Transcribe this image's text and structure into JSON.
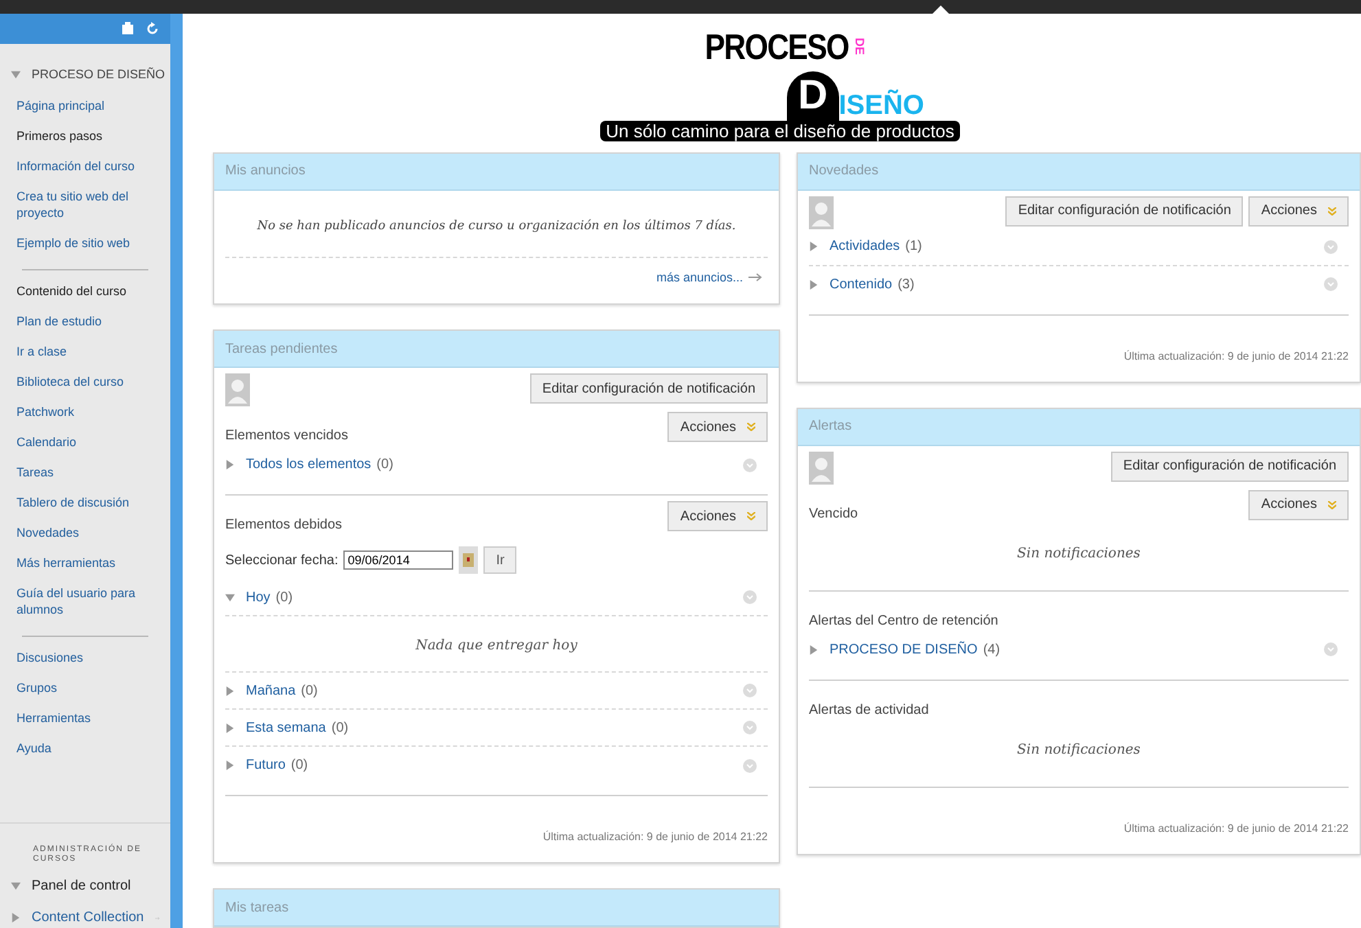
{
  "sidebar": {
    "title": "PROCESO DE DISEÑO",
    "expanded": true,
    "groups": [
      {
        "items": [
          {
            "label": "Página principal",
            "kind": "link"
          },
          {
            "label": "Primeros pasos",
            "kind": "heading"
          },
          {
            "label": "Información del curso",
            "kind": "link"
          },
          {
            "label": "Crea tu sitio web del proyecto",
            "kind": "link"
          },
          {
            "label": "Ejemplo de sitio web",
            "kind": "link"
          }
        ]
      },
      {
        "items": [
          {
            "label": "Contenido del curso",
            "kind": "heading"
          },
          {
            "label": "Plan de estudio",
            "kind": "link"
          },
          {
            "label": "Ir a clase",
            "kind": "link"
          },
          {
            "label": "Biblioteca del curso",
            "kind": "link"
          },
          {
            "label": "Patchwork",
            "kind": "link"
          },
          {
            "label": "Calendario",
            "kind": "link"
          },
          {
            "label": "Tareas",
            "kind": "link"
          },
          {
            "label": "Tablero de discusión",
            "kind": "link"
          },
          {
            "label": "Novedades",
            "kind": "link"
          },
          {
            "label": "Más herramientas",
            "kind": "link"
          },
          {
            "label": "Guía del usuario para alumnos",
            "kind": "link"
          }
        ]
      },
      {
        "items": [
          {
            "label": "Discusiones",
            "kind": "link"
          },
          {
            "label": "Grupos",
            "kind": "link"
          },
          {
            "label": "Herramientas",
            "kind": "link"
          },
          {
            "label": "Ayuda",
            "kind": "link"
          }
        ]
      }
    ],
    "admin": {
      "title": "ADMINISTRACIÓN DE CURSOS",
      "items": [
        {
          "label": "Panel de control",
          "expanded": true,
          "kind": "heading"
        },
        {
          "label": "Content Collection",
          "expanded": false,
          "kind": "link"
        }
      ]
    }
  },
  "logo": {
    "title": "PROCESO",
    "connector": "DE",
    "initial": "D",
    "rest": "ISEÑO",
    "tagline": "Un sólo camino para el diseño de productos"
  },
  "columns": [
    [
      {
        "title": "Mis anuncios",
        "blocks": [
          {
            "kind": "message",
            "text": "No se han publicado anuncios de curso u organización en los últimos 7 días."
          },
          {
            "kind": "more",
            "text": "más anuncios..."
          }
        ]
      },
      {
        "title": "Tareas pendientes",
        "blocks": [
          {
            "kind": "toolbar",
            "buttons": [
              "Editar configuración de notificación"
            ]
          },
          {
            "kind": "section",
            "title": "Elementos vencidos",
            "action": "Acciones",
            "rows": [
              {
                "label": "Todos los elementos",
                "count": "(0)",
                "expanded": false
              }
            ]
          },
          {
            "kind": "section",
            "title": "Elementos debidos",
            "action": "Acciones",
            "date": {
              "label": "Seleccionar fecha:",
              "value": "09/06/2014",
              "go": "Ir"
            },
            "rows": [
              {
                "label": "Hoy",
                "count": "(0)",
                "expanded": true,
                "message": "Nada que entregar hoy"
              },
              {
                "label": "Mañana",
                "count": "(0)",
                "expanded": false
              },
              {
                "label": "Esta semana",
                "count": "(0)",
                "expanded": false
              },
              {
                "label": "Futuro",
                "count": "(0)",
                "expanded": false
              }
            ]
          },
          {
            "kind": "footer",
            "text": "Última actualización: 9 de junio de 2014 21:22"
          }
        ]
      },
      {
        "title": "Mis tareas"
      }
    ],
    [
      {
        "title": "Novedades",
        "blocks": [
          {
            "kind": "toolbar",
            "buttons": [
              "Editar configuración de notificación"
            ],
            "action": "Acciones"
          },
          {
            "kind": "section",
            "rows": [
              {
                "label": "Actividades",
                "count": "(1)",
                "expanded": false
              },
              {
                "label": "Contenido",
                "count": "(3)",
                "expanded": false
              }
            ]
          },
          {
            "kind": "footer",
            "text": "Última actualización: 9 de junio de 2014 21:22"
          }
        ]
      },
      {
        "title": "Alertas",
        "blocks": [
          {
            "kind": "toolbar",
            "buttons": [
              "Editar configuración de notificación"
            ]
          },
          {
            "kind": "section",
            "title": "Vencido",
            "action": "Acciones",
            "message": "Sin notificaciones"
          },
          {
            "kind": "section",
            "title": "Alertas del Centro de retención",
            "rows": [
              {
                "label": "PROCESO DE DISEÑO",
                "count": "(4)",
                "expanded": false
              }
            ]
          },
          {
            "kind": "section",
            "title": "Alertas de actividad",
            "message": "Sin notificaciones"
          },
          {
            "kind": "footer",
            "text": "Última actualización: 9 de junio de 2014 21:22"
          }
        ]
      }
    ]
  ]
}
